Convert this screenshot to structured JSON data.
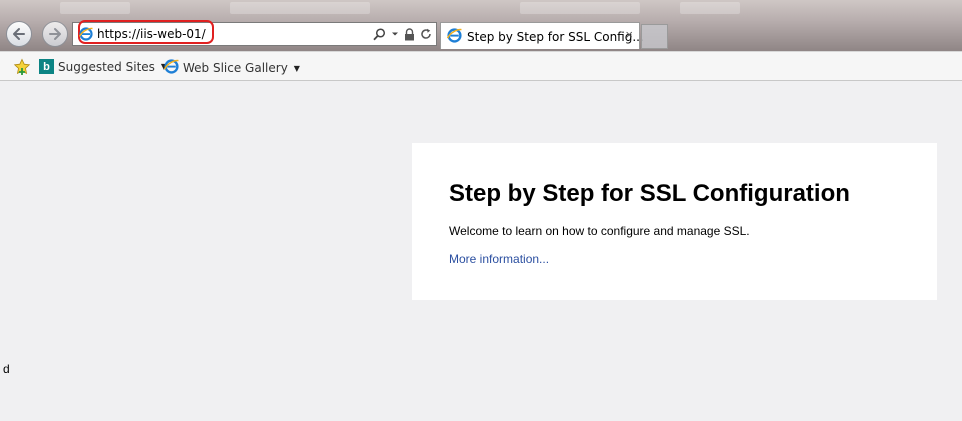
{
  "browser": {
    "address": {
      "url": "https://iis-web-01/"
    },
    "tab": {
      "title": "Step by Step for SSL Config...",
      "close_label": "×"
    },
    "icons": {
      "back": "back-arrow-icon",
      "forward": "forward-arrow-icon",
      "search": "search-icon",
      "dropdown": "chevron-down-icon",
      "lock": "lock-icon",
      "refresh": "refresh-icon",
      "site": "ie-icon"
    },
    "highlight_color": "#e02020"
  },
  "favorites_bar": {
    "items": [
      {
        "label": "Suggested Sites",
        "icon": "bing-icon"
      },
      {
        "label": "Web Slice Gallery",
        "icon": "ie-icon"
      }
    ],
    "bing_letter": "b"
  },
  "page": {
    "heading": "Step by Step for SSL Configuration",
    "welcome": "Welcome to learn on how to configure and manage SSL.",
    "link": "More information...",
    "stray_text": "d",
    "link_color": "#2b4fa0"
  }
}
